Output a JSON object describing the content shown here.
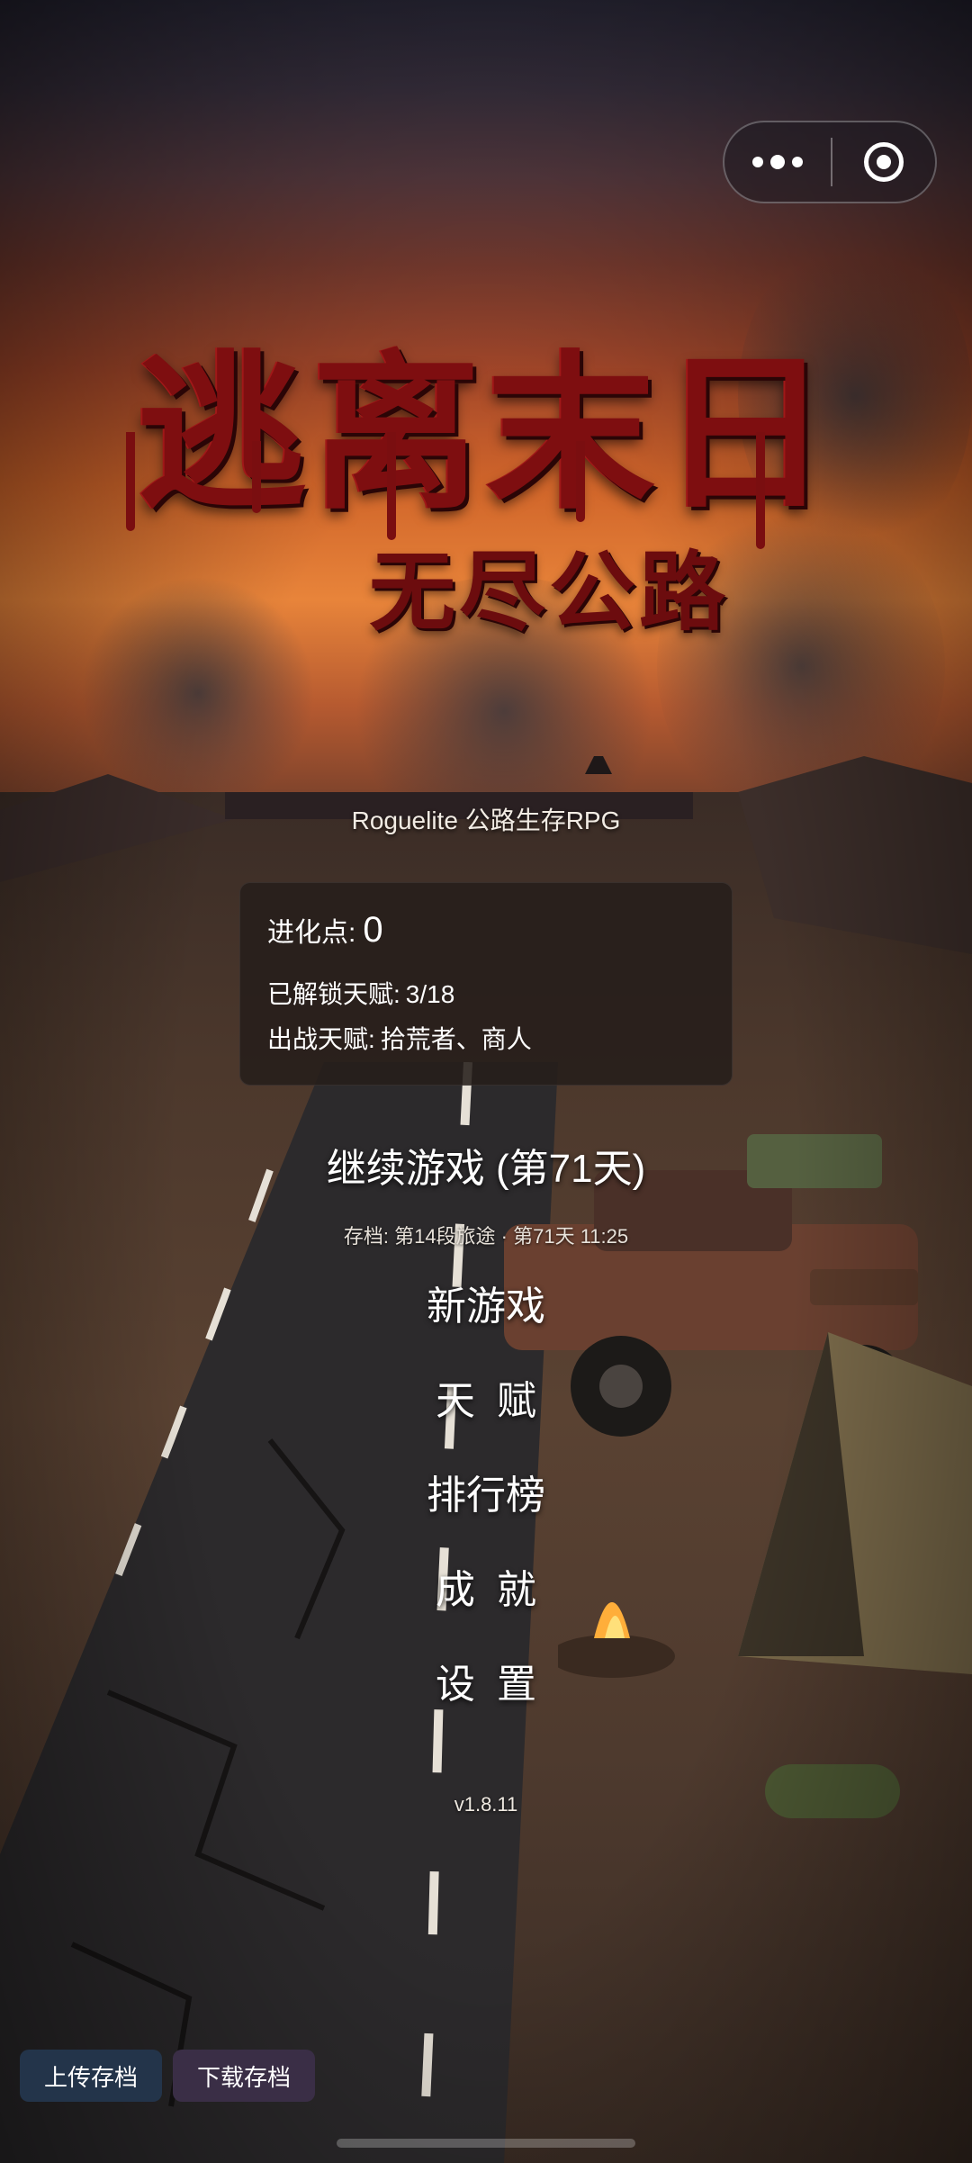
{
  "capsule": {
    "more_icon": "more-dots-icon",
    "close_icon": "target-circle-icon"
  },
  "title": {
    "main": "逃离末日",
    "sub": "无尽公路"
  },
  "subtitle": "Roguelite 公路生存RPG",
  "stats": {
    "evolution_label": "进化点:",
    "evolution_value": "0",
    "unlocked_label": "已解锁天赋:",
    "unlocked_value": "3/18",
    "active_label": "出战天赋:",
    "active_value": "拾荒者、商人"
  },
  "menu": {
    "continue": "继续游戏 (第71天)",
    "save_info": "存档: 第14段旅途 · 第71天 11:25",
    "new_game": "新游戏",
    "talent": "天赋",
    "leaderboard": "排行榜",
    "achievements": "成就",
    "settings": "设置"
  },
  "version": "v1.8.11",
  "buttons": {
    "upload": "上传存档",
    "download": "下载存档"
  },
  "colors": {
    "title_red": "#7e0e10",
    "panel_bg": "#261e1a",
    "upload_btn": "#23344a",
    "download_btn": "#3a2e46"
  }
}
